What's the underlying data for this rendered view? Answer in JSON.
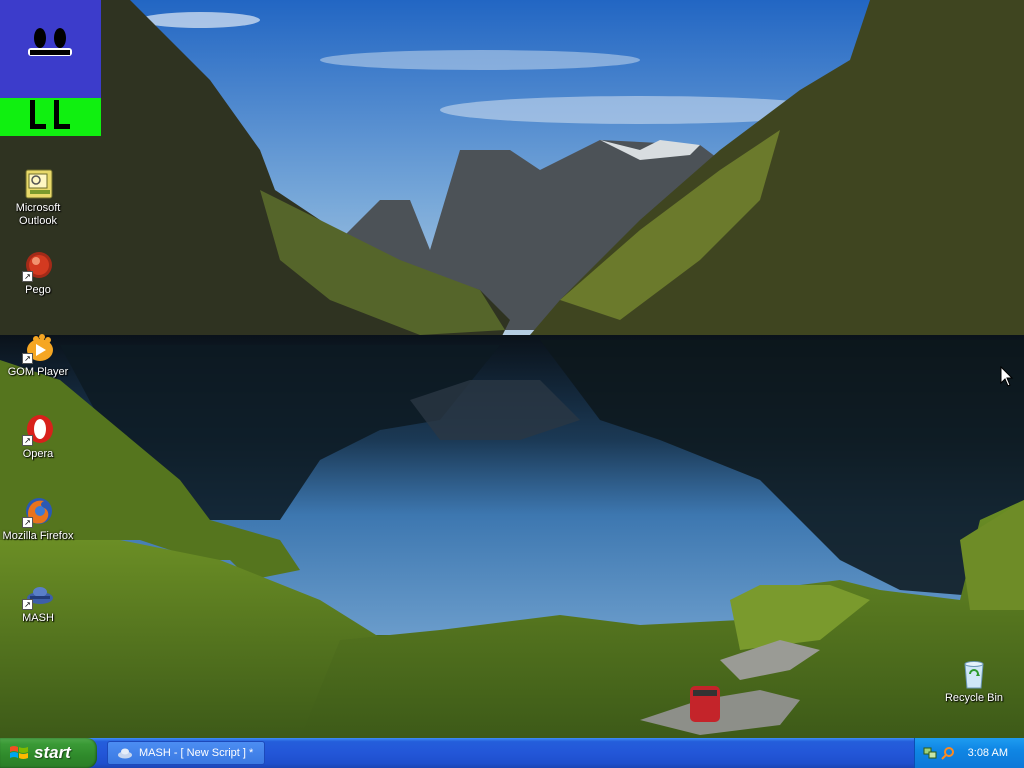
{
  "desktop": {
    "icons": [
      {
        "label": "Microsoft Outlook",
        "icon": "outlook-icon",
        "shortcut": false
      },
      {
        "label": "Pego",
        "icon": "pego-icon",
        "shortcut": true
      },
      {
        "label": "GOM Player",
        "icon": "gom-player-icon",
        "shortcut": true
      },
      {
        "label": "Opera",
        "icon": "opera-icon",
        "shortcut": true
      },
      {
        "label": "Mozilla Firefox",
        "icon": "firefox-icon",
        "shortcut": true
      },
      {
        "label": "MASH",
        "icon": "mash-icon",
        "shortcut": true
      },
      {
        "label": "Recycle Bin",
        "icon": "recycle-bin-icon",
        "shortcut": false
      }
    ]
  },
  "taskbar": {
    "start_label": "start",
    "tasks": [
      {
        "label": "MASH - [ New Script ] *",
        "icon": "mash-icon"
      }
    ],
    "tray": {
      "icons": [
        "network-icon",
        "search-icon"
      ],
      "clock": "3:08 AM"
    }
  },
  "colors": {
    "taskbar_blue": "#245edb",
    "start_green": "#3a9a36",
    "tray_blue": "#0f86e4",
    "logo_blue": "#3c3ccb",
    "logo_green": "#10f010"
  }
}
